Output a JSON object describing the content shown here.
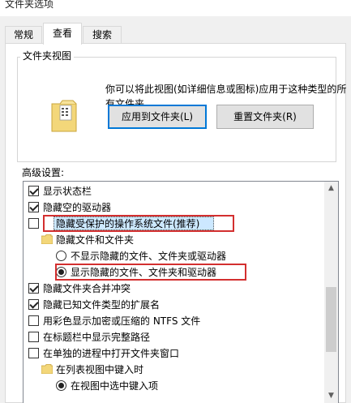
{
  "window": {
    "title": "文件夹选项"
  },
  "tabs": [
    {
      "label": "常规"
    },
    {
      "label": "查看"
    },
    {
      "label": "搜索"
    }
  ],
  "folder_views": {
    "group_title": "文件夹视图",
    "description": "你可以将此视图(如详细信息或图标)应用于这种类型的所有文件夹。",
    "apply_button": "应用到文件夹(L)",
    "reset_button": "重置文件夹(R)"
  },
  "advanced": {
    "label": "高级设置:",
    "items": [
      {
        "type": "checkbox",
        "checked": true,
        "label": "显示状态栏"
      },
      {
        "type": "checkbox",
        "checked": true,
        "label": "隐藏空的驱动器"
      },
      {
        "type": "checkbox",
        "checked": false,
        "label": "隐藏受保护的操作系统文件(推荐)"
      },
      {
        "type": "folder",
        "label": "隐藏文件和文件夹"
      },
      {
        "type": "radio",
        "checked": false,
        "label": "不显示隐藏的文件、文件夹或驱动器"
      },
      {
        "type": "radio",
        "checked": true,
        "label": "显示隐藏的文件、文件夹和驱动器"
      },
      {
        "type": "checkbox",
        "checked": true,
        "label": "隐藏文件夹合并冲突"
      },
      {
        "type": "checkbox",
        "checked": true,
        "label": "隐藏已知文件类型的扩展名"
      },
      {
        "type": "checkbox",
        "checked": false,
        "label": "用彩色显示加密或压缩的 NTFS 文件"
      },
      {
        "type": "checkbox",
        "checked": false,
        "label": "在标题栏中显示完整路径"
      },
      {
        "type": "checkbox",
        "checked": false,
        "label": "在单独的进程中打开文件夹窗口"
      },
      {
        "type": "folder",
        "label": "在列表视图中键入时"
      },
      {
        "type": "radio",
        "checked": true,
        "label": "在视图中选中键入项"
      }
    ]
  },
  "colors": {
    "highlight": "#cce8ff",
    "annotation_red": "#d32f2f",
    "accent": "#0078d7"
  }
}
